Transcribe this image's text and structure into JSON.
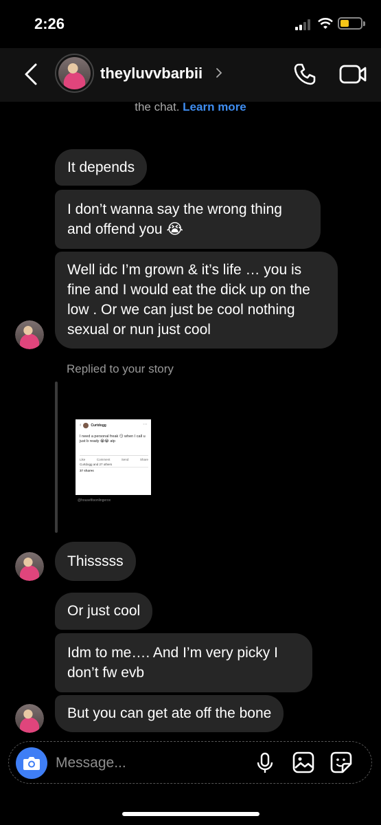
{
  "status_bar": {
    "time": "2:26"
  },
  "header": {
    "username": "theyluvvbarbii"
  },
  "notice": {
    "text": "the chat.",
    "link": "Learn more"
  },
  "messages": [
    "It depends",
    "I don’t wanna say the wrong thing and offend you 😭",
    "Well idc I’m grown & it’s life … you is fine and I would eat the dick up on the low . Or we can just be cool nothing sexual or nun just cool",
    "Thisssss",
    "Or just cool",
    "Idm to me…. And I’m very picky I don’t fw evb",
    "But you can get ate off the bone"
  ],
  "story_reply": {
    "label": "Replied to your story",
    "card": {
      "name": "Curtdogg",
      "text": "I need a personal freak 😏 when I call u just b ready 😭😭 atp",
      "actions": [
        "Like",
        "Comment",
        "Send",
        "Share"
      ],
      "reactions": "Curtdogg and 27 others",
      "shares": "37 shares",
      "tag": "@housefitsonlingerox"
    }
  },
  "composer": {
    "placeholder": "Message..."
  },
  "icons": {
    "back": "chevron-left-icon",
    "phone": "phone-icon",
    "video": "video-camera-icon",
    "camera": "camera-icon",
    "mic": "microphone-icon",
    "gallery": "image-icon",
    "sticker": "sticker-icon"
  },
  "colors": {
    "background": "#000000",
    "bubble": "#262626",
    "link": "#3f8df0",
    "camera_button": "#3f7ef5"
  }
}
